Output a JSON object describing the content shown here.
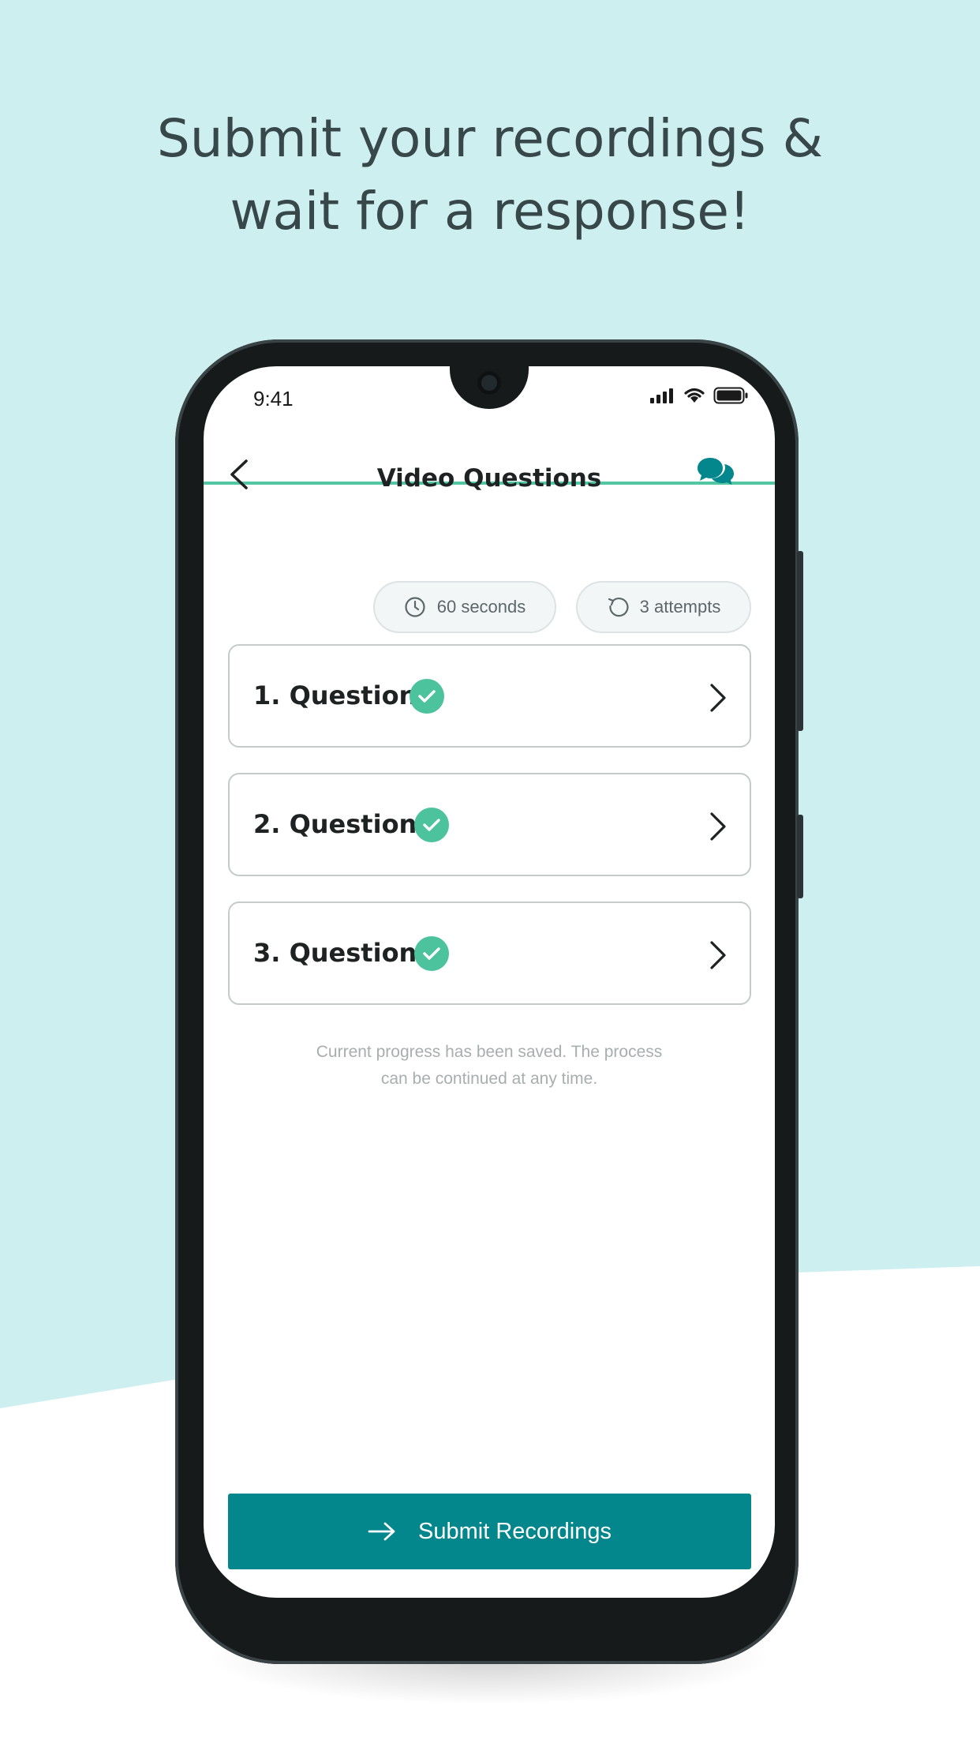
{
  "headline": {
    "line1": "Submit your recordings &",
    "line2": "wait for a response!"
  },
  "status_bar": {
    "time": "9:41"
  },
  "nav": {
    "title": "Video Questions"
  },
  "chips": {
    "seconds": "60 seconds",
    "attempts": "3 attempts"
  },
  "questions": [
    {
      "label": "1. Question"
    },
    {
      "label": "2. Question"
    },
    {
      "label": "3. Question"
    }
  ],
  "progress_note": {
    "line1": "Current progress has been saved. The process",
    "line2": "can be continued at any time."
  },
  "submit": {
    "label": "Submit Recordings"
  },
  "colors": {
    "background_top": "#cdeff0",
    "accent": "#03868c",
    "check": "#4cc29d",
    "nav_underline": "#52c7a2"
  },
  "icons": {
    "back": "chevron-left-icon",
    "chat": "chat-bubbles-icon",
    "clock": "clock-icon",
    "retry": "retry-icon",
    "check": "check-circle-icon",
    "chevron": "chevron-right-icon",
    "arrow": "arrow-right-icon"
  }
}
